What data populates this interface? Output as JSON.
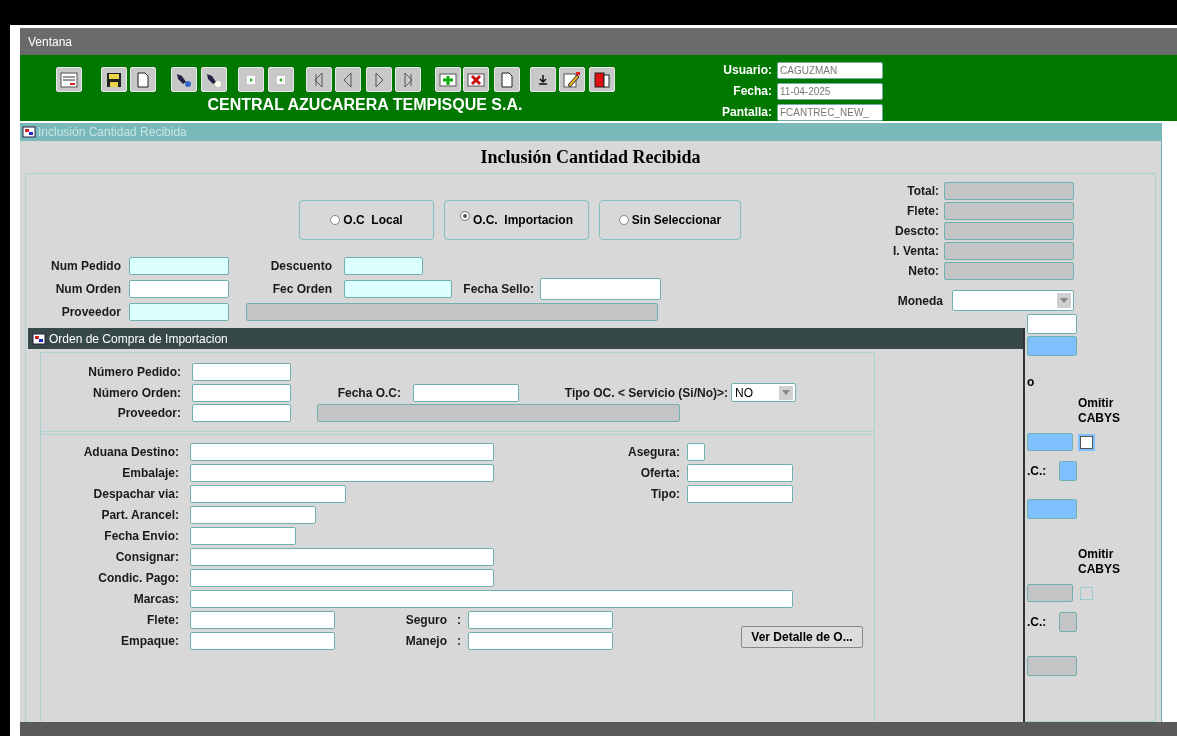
{
  "menu_bar": {
    "items": [
      "Ventana"
    ]
  },
  "toolbar": {
    "company": "CENTRAL AZUCARERA TEMPISQUE S.A.",
    "session": [
      {
        "label": "Usuario:",
        "value": "CAGUZMAN"
      },
      {
        "label": "Fecha:",
        "value": "11-04-2025"
      },
      {
        "label": "Pantalla:",
        "value": "FCANTREC_NEW_"
      }
    ]
  },
  "main_window": {
    "title": "Inclusión Cantidad Recibida",
    "heading": "Inclusión Cantidad Recibida",
    "order_types": [
      {
        "label": "O.C  Local",
        "selected": false
      },
      {
        "label": "O.C.  Importacion",
        "selected": true
      },
      {
        "label": "Sin Seleccionar",
        "selected": false
      }
    ],
    "fields": [
      {
        "label": "Num Pedido",
        "kind": "required"
      },
      {
        "label": "Descuento",
        "kind": "required"
      },
      {
        "label": "Num Orden",
        "kind": "input"
      },
      {
        "label": "Fec Orden",
        "kind": "required"
      },
      {
        "label": "Fecha Sello:",
        "kind": "input"
      },
      {
        "label": "Proveedor",
        "kind": "required"
      },
      {
        "kind": "readonly"
      }
    ],
    "totals": [
      {
        "label": "Total:",
        "kind": "readonly"
      },
      {
        "label": "Flete:",
        "kind": "readonly"
      },
      {
        "label": "Descto:",
        "kind": "readonly"
      },
      {
        "label": "I. Venta:",
        "kind": "readonly"
      },
      {
        "label": "Neto:",
        "kind": "readonly"
      }
    ],
    "currency": {
      "label": "Moneda"
    },
    "partial_column": [
      {
        "kind": "field",
        "field": {
          "kind": "input"
        }
      },
      {
        "kind": "field",
        "field": {
          "kind": "highlighted"
        }
      },
      {
        "kind": "text",
        "text": "o"
      },
      {
        "kind": "check",
        "label": "Omitir CABYS",
        "field": {
          "kind": "highlighted"
        },
        "checked": false,
        "disabled": false
      },
      {
        "kind": "labeled",
        "text": ".C.:",
        "field": {
          "kind": "highlighted"
        }
      },
      {
        "kind": "field",
        "field": {
          "kind": "highlighted"
        }
      },
      {
        "kind": "check",
        "label": "Omitir CABYS",
        "field": {
          "kind": "readonly"
        },
        "checked": false,
        "disabled": true
      },
      {
        "kind": "labeled",
        "text": ".C.:",
        "field": {
          "kind": "readonly"
        }
      },
      {
        "kind": "field",
        "field": {
          "kind": "readonly"
        }
      }
    ]
  },
  "dialog": {
    "title": "Orden de Compra de Importacion",
    "header": [
      {
        "label": "Número Pedido:"
      },
      {
        "label": "Número Orden:"
      },
      {
        "label": "Fecha O.C:"
      },
      {
        "label": "Tipo OC. < Servicio (Si/No)>:",
        "value": "NO"
      },
      {
        "label": "Proveedor:"
      }
    ],
    "details": [
      {
        "label": "Aduana Destino:"
      },
      {
        "label": "Asegura:"
      },
      {
        "label": "Embalaje:"
      },
      {
        "label": "Oferta:"
      },
      {
        "label": "Despachar via:"
      },
      {
        "label": "Tipo:"
      },
      {
        "label": "Part. Arancel:"
      },
      {
        "label": "Fecha Envio:"
      },
      {
        "label": "Consignar:"
      },
      {
        "label": "Condic. Pago:"
      },
      {
        "label": "Marcas:"
      },
      {
        "label": "Flete:"
      },
      {
        "label": "Seguro   :"
      },
      {
        "label": "Empaque:"
      },
      {
        "label": "Manejo   :"
      }
    ],
    "button": "Ver Detalle de O..."
  }
}
